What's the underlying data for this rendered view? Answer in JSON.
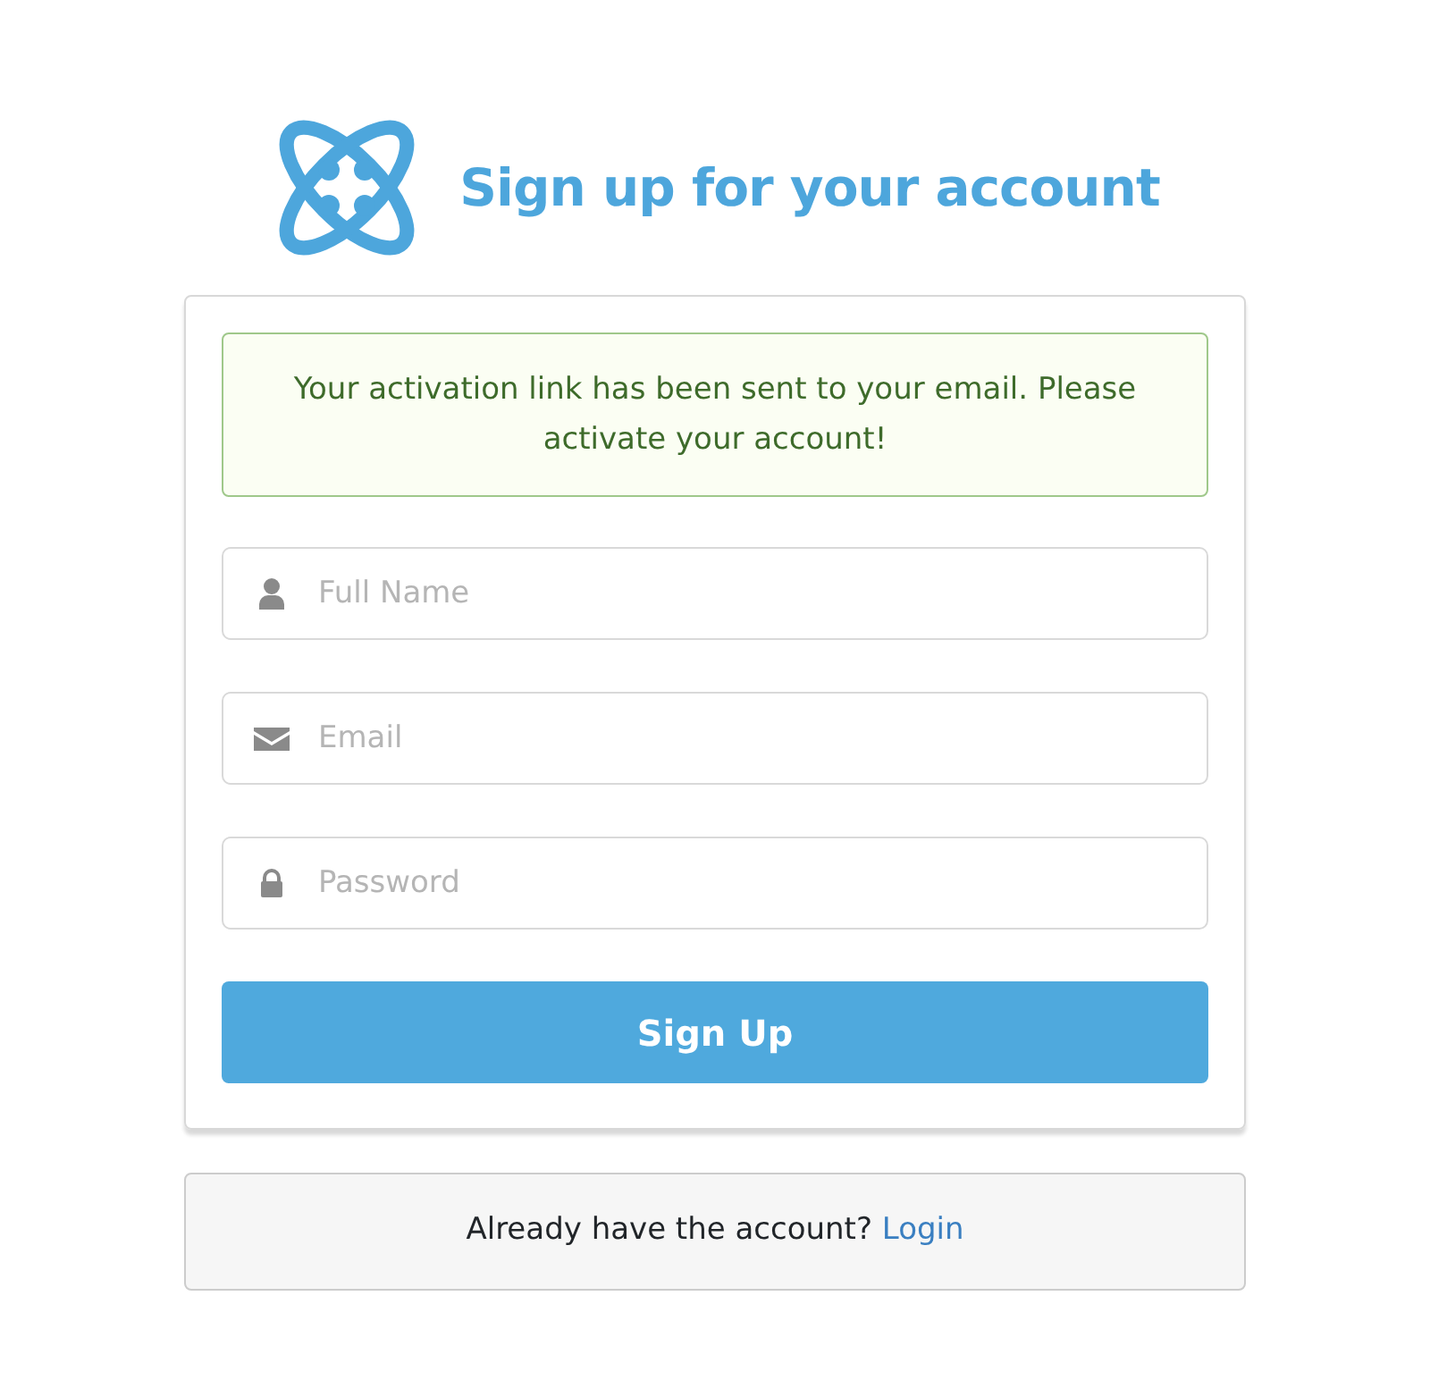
{
  "header": {
    "title": "Sign up for your account"
  },
  "alert": {
    "message": "Your activation link has been sent to your email. Please activate your account!"
  },
  "fields": [
    {
      "kind": "person",
      "placeholder": "Full Name"
    },
    {
      "kind": "email",
      "placeholder": "Email"
    },
    {
      "kind": "password",
      "placeholder": "Password"
    }
  ],
  "submit_button": "Sign Up",
  "footer": {
    "prompt": "Already have the account?",
    "link": "Login"
  }
}
